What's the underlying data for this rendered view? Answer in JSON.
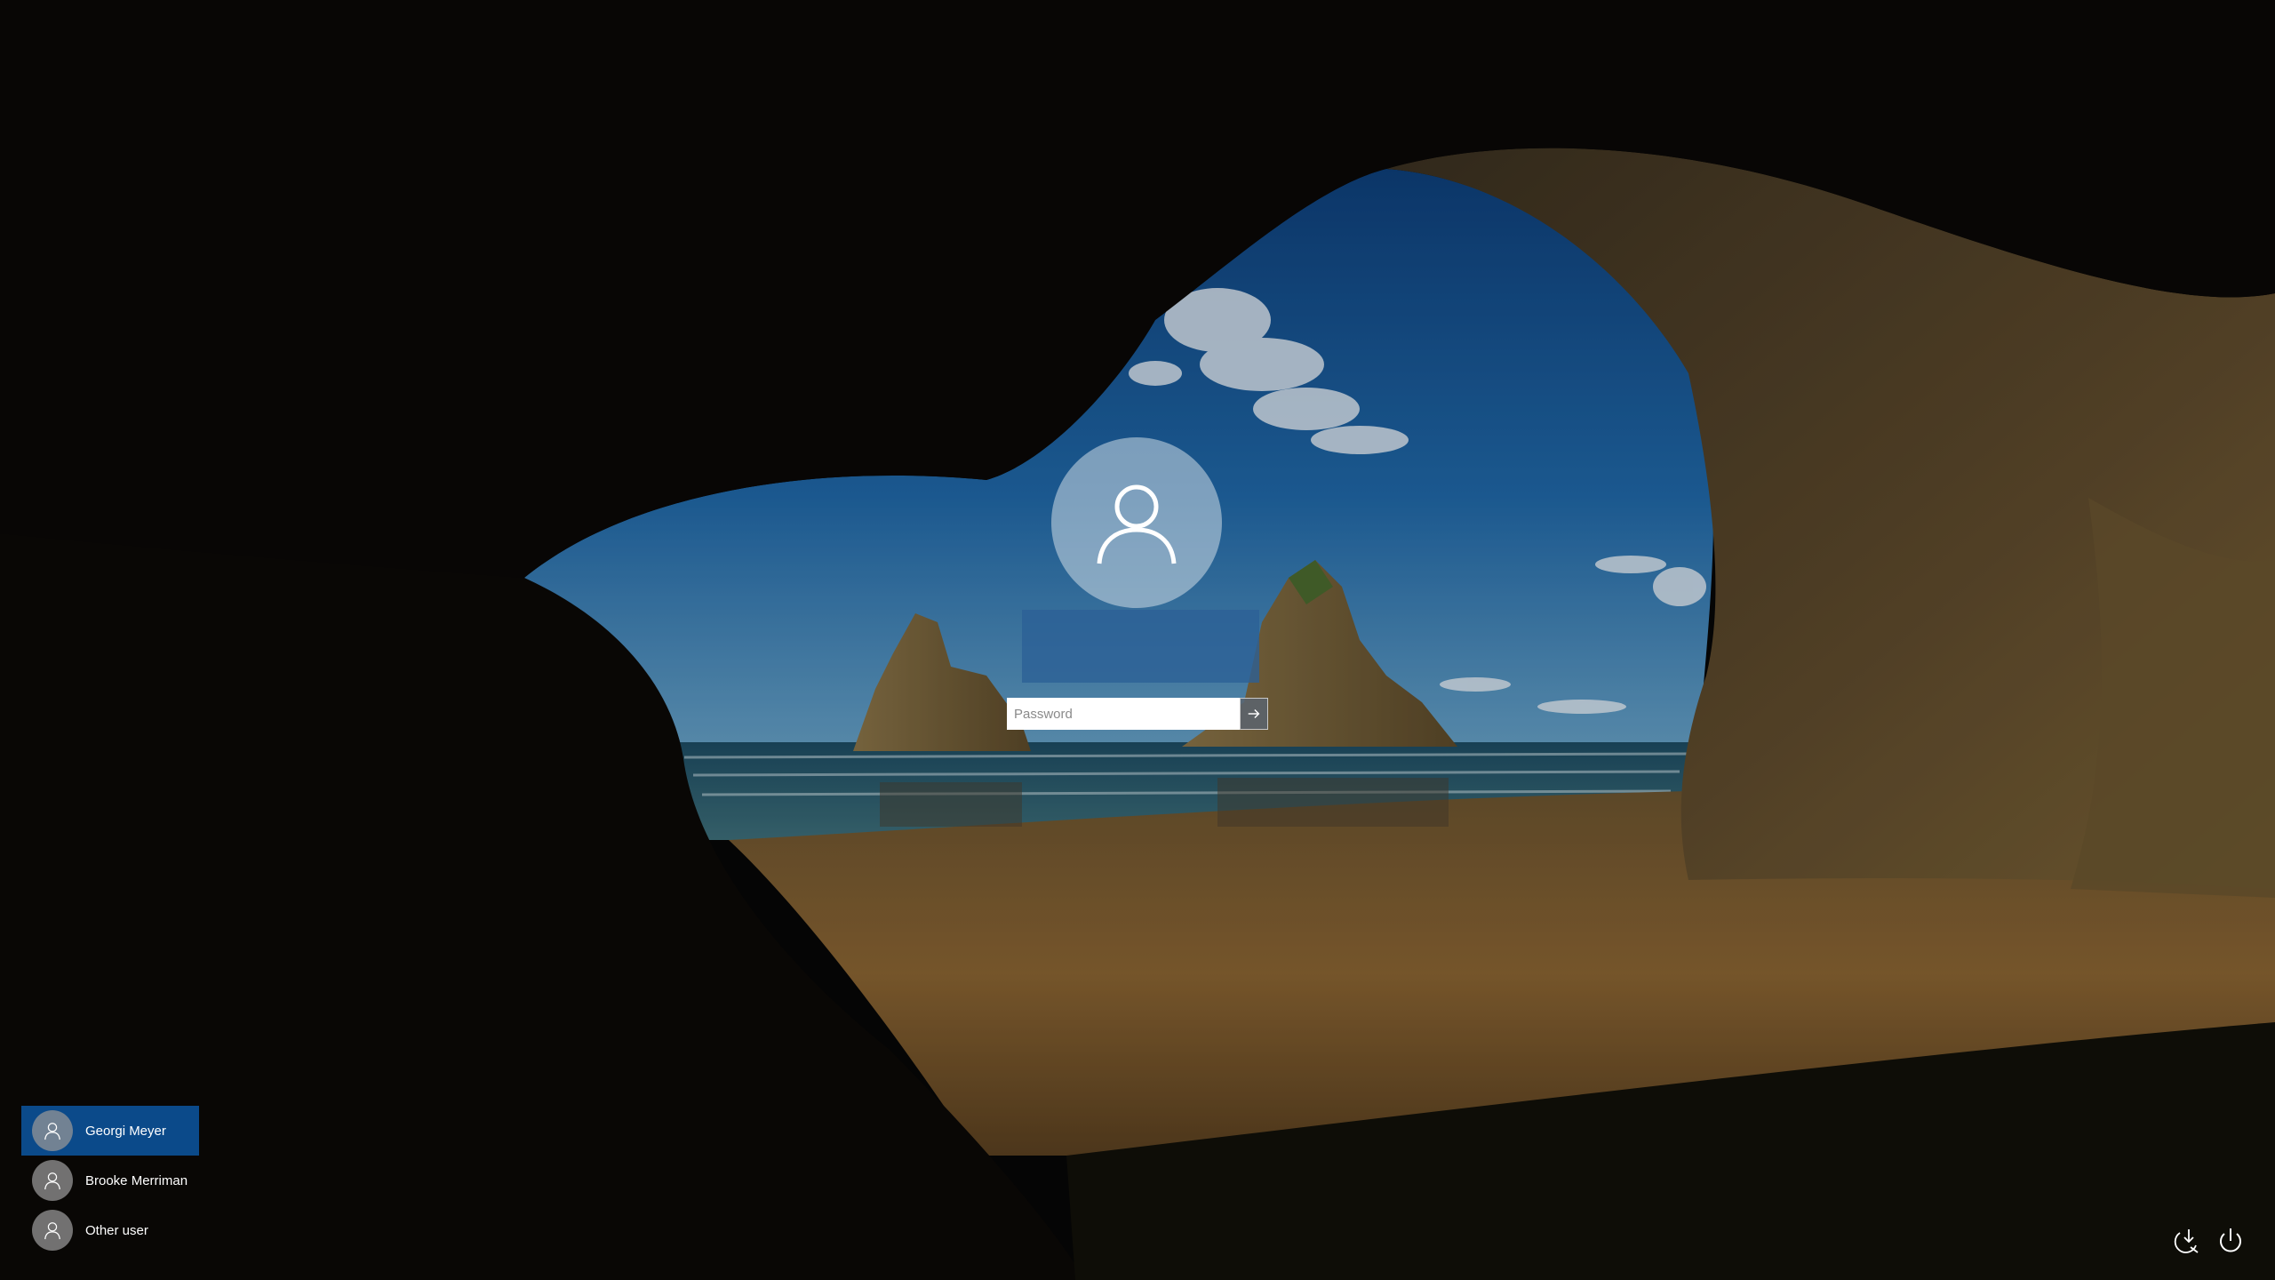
{
  "login": {
    "username": "",
    "password_placeholder": "Password",
    "password_value": ""
  },
  "users": [
    {
      "name": "Georgi Meyer",
      "selected": true
    },
    {
      "name": "Brooke Merriman",
      "selected": false
    },
    {
      "name": "Other user",
      "selected": false
    }
  ],
  "icons": {
    "avatar": "user-icon",
    "submit": "arrow-right-icon",
    "accessibility": "ease-of-access-icon",
    "power": "power-icon"
  },
  "colors": {
    "selected_user_bg": "#0b4a8a",
    "username_box_bg": "#2c6096"
  }
}
